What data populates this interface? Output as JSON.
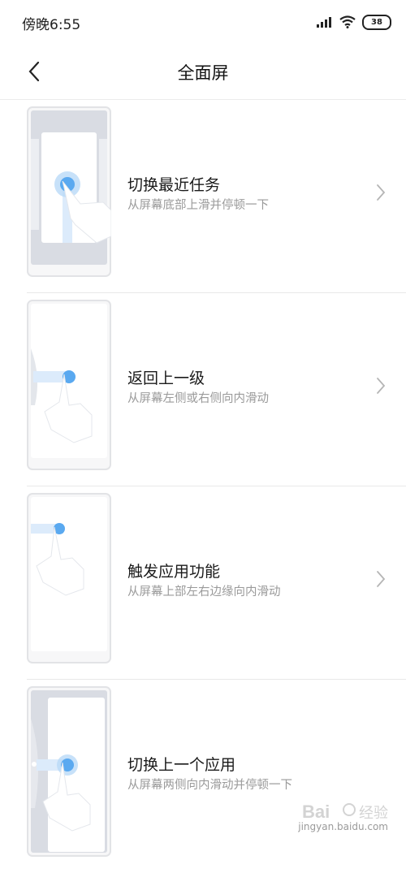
{
  "status_bar": {
    "time": "傍晚6:55",
    "battery": "38",
    "icons": [
      "signal-icon",
      "wifi-icon",
      "battery-icon"
    ]
  },
  "header": {
    "title": "全面屏",
    "back_icon": "chevron-left-icon"
  },
  "items": [
    {
      "title": "切换最近任务",
      "subtitle": "从屏幕底部上滑并停顿一下",
      "icon": "chevron-right-icon"
    },
    {
      "title": "返回上一级",
      "subtitle": "从屏幕左侧或右侧向内滑动",
      "icon": "chevron-right-icon"
    },
    {
      "title": "触发应用功能",
      "subtitle": "从屏幕上部左右边缘向内滑动",
      "icon": "chevron-right-icon"
    },
    {
      "title": "切换上一个应用",
      "subtitle": "从屏幕两侧向内滑动并停顿一下",
      "icon": "chevron-right-icon"
    }
  ],
  "watermark": {
    "text": "jingyan.baidu.com"
  },
  "colors": {
    "accent_blue": "#5aa9f0",
    "divider": "#e8e8e8",
    "subtitle_gray": "#9a9a9a"
  }
}
